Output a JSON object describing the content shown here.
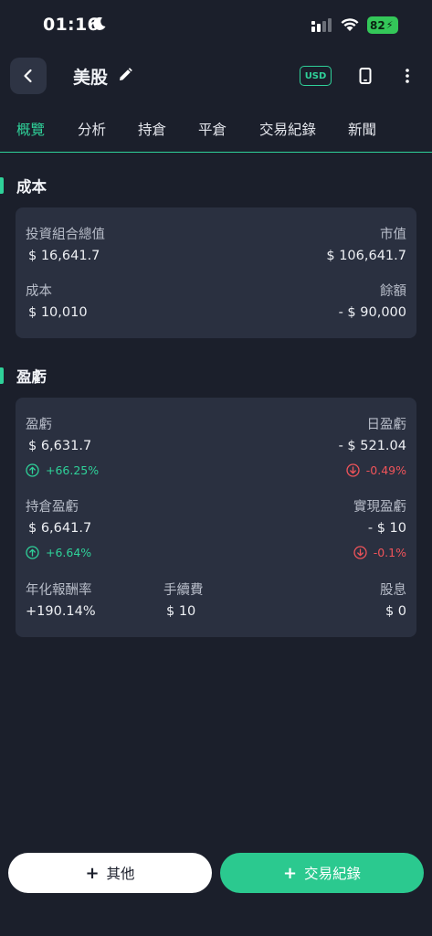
{
  "status_bar": {
    "time": "01:16",
    "battery": "82"
  },
  "header": {
    "title": "美股",
    "currency_badge": "USD"
  },
  "tabs": [
    {
      "label": "概覽",
      "active": true
    },
    {
      "label": "分析",
      "active": false
    },
    {
      "label": "持倉",
      "active": false
    },
    {
      "label": "平倉",
      "active": false
    },
    {
      "label": "交易紀錄",
      "active": false
    },
    {
      "label": "新聞",
      "active": false
    }
  ],
  "cost_section": {
    "title": "成本",
    "portfolio_total_label": "投資組合總值",
    "portfolio_total_value": "$ 16,641.7",
    "market_value_label": "市值",
    "market_value_value": "$ 106,641.7",
    "cost_label": "成本",
    "cost_value": "$ 10,010",
    "balance_label": "餘額",
    "balance_value": "- $ 90,000"
  },
  "pnl_section": {
    "title": "盈虧",
    "pnl_label": "盈虧",
    "pnl_value": "$ 6,631.7",
    "pnl_pct": "+66.25%",
    "daily_pnl_label": "日盈虧",
    "daily_pnl_value": "- $ 521.04",
    "daily_pnl_pct": "-0.49%",
    "holding_pnl_label": "持倉盈虧",
    "holding_pnl_value": "$ 6,641.7",
    "holding_pnl_pct": "+6.64%",
    "realized_pnl_label": "實現盈虧",
    "realized_pnl_value": "- $ 10",
    "realized_pnl_pct": "-0.1%",
    "annual_return_label": "年化報酬率",
    "annual_return_value": "+190.14%",
    "fees_label": "手續費",
    "fees_value": "$ 10",
    "dividends_label": "股息",
    "dividends_value": "$ 0"
  },
  "buttons": {
    "other": "其他",
    "trade_record": "交易紀錄"
  },
  "icons": {
    "back": "chevron-left-icon",
    "edit": "pencil-icon",
    "phone": "phone-icon",
    "more": "more-vertical-icon",
    "up": "arrow-up-circle-icon",
    "down": "arrow-down-circle-icon",
    "plus": "plus-icon"
  },
  "colors": {
    "accent": "#2fd199",
    "negative": "#f0545a",
    "background": "#1b1f2b",
    "card": "#2a3040"
  }
}
